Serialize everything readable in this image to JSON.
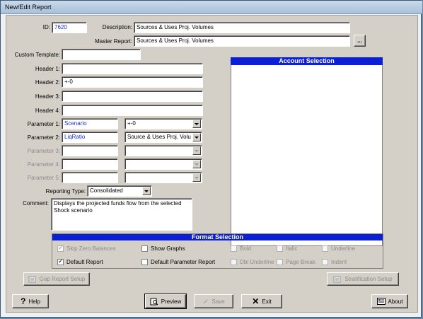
{
  "window": {
    "title": "New/Edit Report"
  },
  "fields": {
    "id_label": "ID:",
    "id_value": "7620",
    "description_label": "Description:",
    "description_value": "Sources & Uses Proj. Volumes",
    "master_label": "Master Report:",
    "master_value": "Sources & Uses Proj. Volumes",
    "master_browse": "...",
    "custom_template_label": "Custom Template:",
    "custom_template_value": "",
    "header1_label": "Header 1:",
    "header1_value": "",
    "header2_label": "Header 2:",
    "header2_value": "+-0",
    "header3_label": "Header 3:",
    "header3_value": "",
    "header4_label": "Header 4:",
    "header4_value": ""
  },
  "parameters": [
    {
      "label": "Parameter 1:",
      "name": "Scenario",
      "value": "+-0",
      "enabled": true
    },
    {
      "label": "Parameter 2:",
      "name": "LiqRatio",
      "value": "Source & Uses Proj. Volum",
      "enabled": true
    },
    {
      "label": "Parameter 3:",
      "name": "",
      "value": "",
      "enabled": false
    },
    {
      "label": "Parameter 4:",
      "name": "",
      "value": "",
      "enabled": false
    },
    {
      "label": "Parameter 5:",
      "name": "",
      "value": "",
      "enabled": false
    }
  ],
  "reporting": {
    "label": "Reporting Type:",
    "value": "Consolidated"
  },
  "comment": {
    "label": "Comment:",
    "value": "Displays the projected funds flow from the selected\nShock scenario"
  },
  "account_selection": {
    "title": "Account Selection"
  },
  "format_selection": {
    "title": "Format Selection",
    "options": [
      {
        "label": "Skip Zero Balances",
        "checked": true,
        "enabled": false
      },
      {
        "label": "Show Graphs",
        "checked": false,
        "enabled": true
      },
      {
        "label": "Bold",
        "checked": false,
        "enabled": false
      },
      {
        "label": "Italic",
        "checked": false,
        "enabled": false
      },
      {
        "label": "Underline",
        "checked": false,
        "enabled": false
      },
      {
        "label": "Default Report",
        "checked": true,
        "enabled": true
      },
      {
        "label": "Default Parameter Report",
        "checked": false,
        "enabled": true
      },
      {
        "label": "Dbl Underline",
        "checked": false,
        "enabled": false
      },
      {
        "label": "Page Break",
        "checked": false,
        "enabled": false
      },
      {
        "label": "Indent",
        "checked": false,
        "enabled": false
      }
    ]
  },
  "buttons": {
    "gap_report_setup": "Gap Report Setup",
    "stratification_setup": "Stratification Setup",
    "help": "Help",
    "preview": "Preview",
    "save": "Save",
    "exit": "Exit",
    "about": "About"
  },
  "colors": {
    "accent": "#0a1fd6",
    "value_text": "#1b2fd0",
    "face": "#d4d0c8"
  }
}
